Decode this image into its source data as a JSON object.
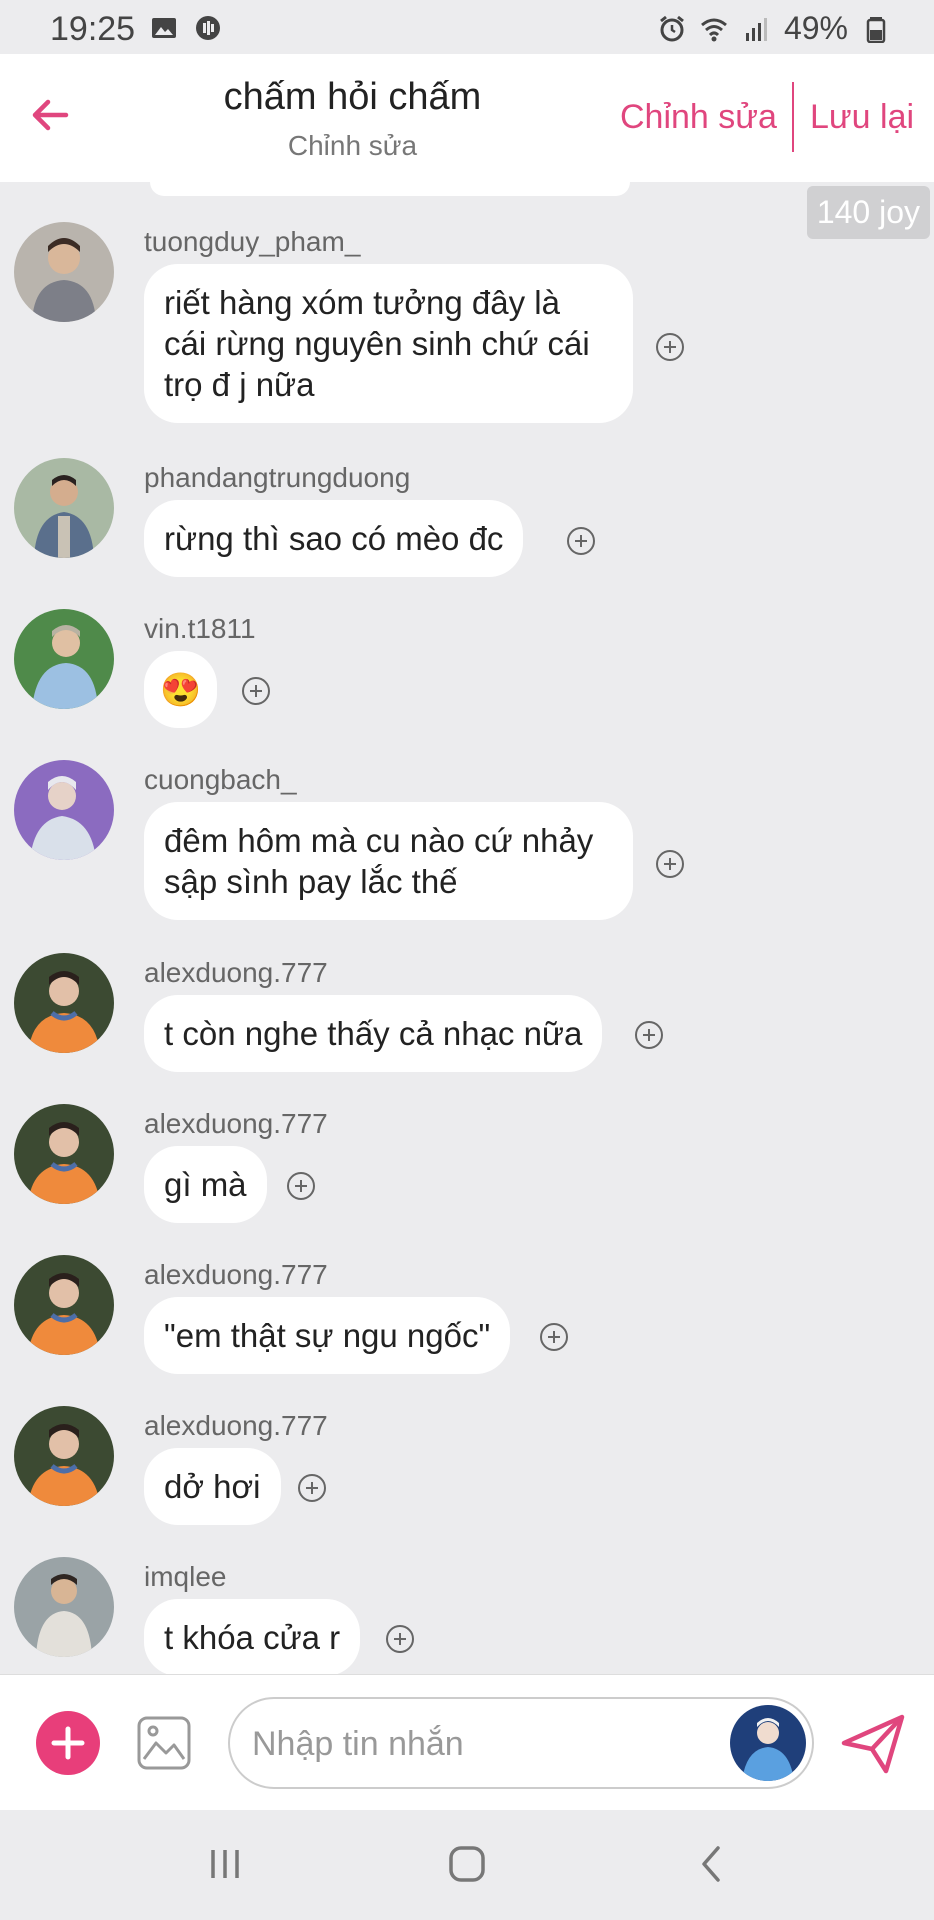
{
  "status": {
    "time": "19:25",
    "battery": "49%"
  },
  "header": {
    "title": "chấm hỏi chấm",
    "subtitle": "Chỉnh sửa",
    "edit_label": "Chỉnh sửa",
    "save_label": "Lưu lại"
  },
  "joy_badge": "140 joy",
  "messages": [
    {
      "user": "tuongduy_pham_",
      "lines": [
        "riết hàng xóm tưởng đây là",
        "cái rừng nguyên sinh chứ cái",
        "trọ đ j nữa"
      ]
    },
    {
      "user": "phandangtrungduong",
      "lines": [
        "rừng thì sao có mèo đc"
      ]
    },
    {
      "user": "vin.t1811",
      "lines": [
        "😍"
      ]
    },
    {
      "user": "cuongbach_",
      "lines": [
        "đêm hôm mà cu nào cứ nhảy",
        "sập sình pay lắc thế"
      ]
    },
    {
      "user": "alexduong.777",
      "lines": [
        "t còn nghe thấy cả nhạc nữa"
      ]
    },
    {
      "user": "alexduong.777",
      "lines": [
        "gì mà"
      ]
    },
    {
      "user": "alexduong.777",
      "lines": [
        "\"em thật sự ngu ngốc\""
      ]
    },
    {
      "user": "alexduong.777",
      "lines": [
        "dở hơi"
      ]
    },
    {
      "user": "imqlee",
      "lines": [
        "t khóa cửa r"
      ]
    }
  ],
  "composer": {
    "placeholder": "Nhập tin nhắn"
  },
  "colors": {
    "accent": "#e0467e",
    "background": "#ececee",
    "bubble": "#ffffff"
  }
}
